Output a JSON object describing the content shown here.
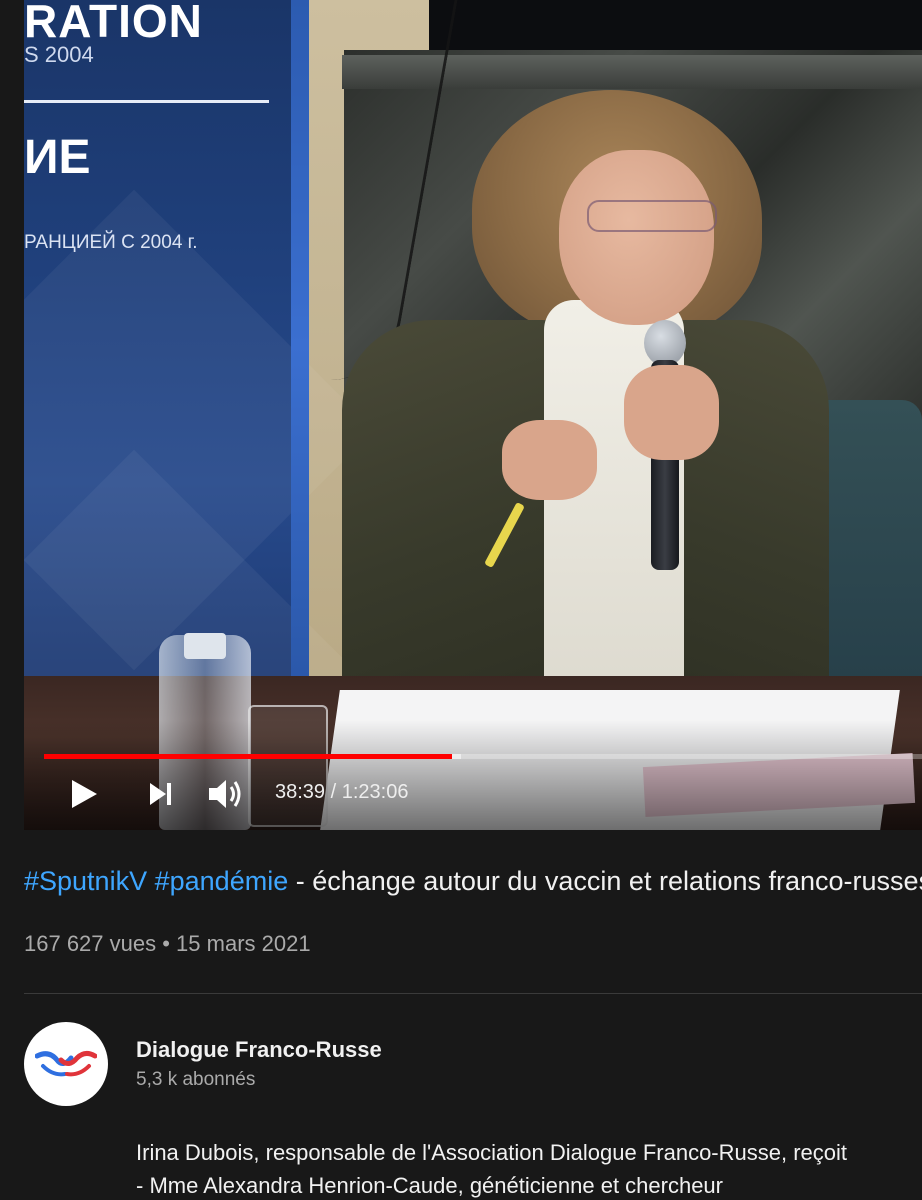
{
  "video": {
    "banner": {
      "word": "RATION",
      "year": "S 2004",
      "big": "ИЕ",
      "ru_line": "РАНЦИЕЙ С 2004 г."
    },
    "player": {
      "time_current": "38:39",
      "time_separator": " / ",
      "time_total": "1:23:06",
      "progress_played": 0.465,
      "progress_buffered": 0.475,
      "accent_color": "#ff0000"
    }
  },
  "info": {
    "title_hashtag_1": "#SputnikV",
    "title_hashtag_2": "#pandémie",
    "title_rest": " - échange autour du vaccin et relations franco-russes",
    "views": "167 627 vues",
    "separator": " • ",
    "date": "15 mars 2021",
    "hashtag_color": "#3ea6ff"
  },
  "channel": {
    "name": "Dialogue Franco-Russe",
    "subscribers": "5,3 k abonnés",
    "avatar_icon": "dialogue-franco-russe-logo"
  },
  "description": {
    "line1": "Irina Dubois, responsable de l'Association Dialogue Franco-Russe, reçoit",
    "line2": "- Mme Alexandra Henrion-Caude, généticienne et chercheur"
  }
}
